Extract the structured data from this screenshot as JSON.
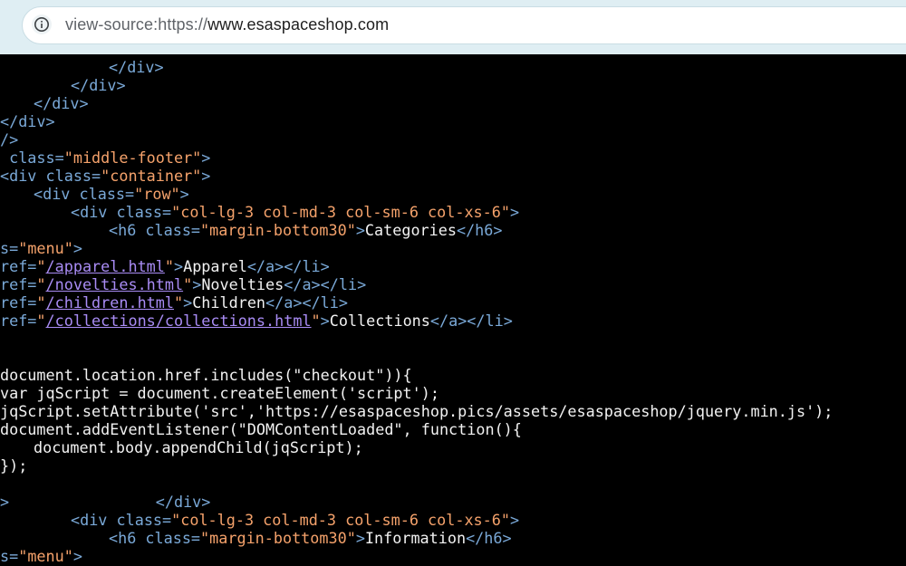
{
  "browser": {
    "url_scheme": "view-source:https://",
    "url_host": "www.esaspaceshop.com"
  },
  "icons": {
    "site_info": "info-icon"
  },
  "colors": {
    "chrome": "#dfeef3",
    "background": "#000000",
    "tag": "#7aa9d8",
    "attribute_value": "#f5a26b",
    "link": "#a98cf5",
    "text": "#f2f2f2"
  },
  "source_lines": [
    {
      "segments": []
    },
    {
      "segments": [
        {
          "t": "</div>",
          "c": "tag"
        }
      ]
    },
    {
      "segments": [
        {
          "t": "</div>",
          "c": "tag"
        }
      ]
    },
    {
      "segments": [
        {
          "t": "</div>",
          "c": "tag"
        }
      ]
    },
    {
      "segments": [
        {
          "t": "</div>",
          "c": "tag"
        }
      ]
    },
    {
      "segments": [
        {
          "t": "/>",
          "c": "tag"
        }
      ]
    },
    {
      "segments": [
        {
          "t": " class=",
          "c": "attr"
        },
        {
          "t": "\"middle-footer\"",
          "c": "val"
        },
        {
          "t": ">",
          "c": "tag"
        }
      ]
    },
    {
      "segments": [
        {
          "t": "<div class=",
          "c": "tag"
        },
        {
          "t": "\"container\"",
          "c": "val"
        },
        {
          "t": ">",
          "c": "tag"
        }
      ]
    },
    {
      "segments": [
        {
          "t": "<div class=",
          "c": "tag"
        },
        {
          "t": "\"row\"",
          "c": "val"
        },
        {
          "t": ">",
          "c": "tag"
        }
      ]
    },
    {
      "segments": [
        {
          "t": "<div class=",
          "c": "tag"
        },
        {
          "t": "\"col-lg-3 col-md-3 col-sm-6 col-xs-6\"",
          "c": "val"
        },
        {
          "t": ">",
          "c": "tag"
        }
      ]
    },
    {
      "segments": [
        {
          "t": "<h6 class=",
          "c": "tag"
        },
        {
          "t": "\"margin-bottom30\"",
          "c": "val"
        },
        {
          "t": ">",
          "c": "tag"
        },
        {
          "t": "Categories",
          "c": "txt"
        },
        {
          "t": "</h6>",
          "c": "tag"
        }
      ]
    },
    {
      "segments": [
        {
          "t": "s=",
          "c": "attr"
        },
        {
          "t": "\"menu\"",
          "c": "val"
        },
        {
          "t": ">",
          "c": "tag"
        }
      ]
    },
    {
      "segments": [
        {
          "t": "ref=",
          "c": "attr"
        },
        {
          "t": "\"",
          "c": "val"
        },
        {
          "t": "/apparel.html",
          "c": "link"
        },
        {
          "t": "\"",
          "c": "val"
        },
        {
          "t": ">",
          "c": "tag"
        },
        {
          "t": "Apparel",
          "c": "txt"
        },
        {
          "t": "</a></li>",
          "c": "tag"
        }
      ]
    },
    {
      "segments": [
        {
          "t": "ref=",
          "c": "attr"
        },
        {
          "t": "\"",
          "c": "val"
        },
        {
          "t": "/novelties.html",
          "c": "link"
        },
        {
          "t": "\"",
          "c": "val"
        },
        {
          "t": ">",
          "c": "tag"
        },
        {
          "t": "Novelties",
          "c": "txt"
        },
        {
          "t": "</a></li>",
          "c": "tag"
        }
      ]
    },
    {
      "segments": [
        {
          "t": "ref=",
          "c": "attr"
        },
        {
          "t": "\"",
          "c": "val"
        },
        {
          "t": "/children.html",
          "c": "link"
        },
        {
          "t": "\"",
          "c": "val"
        },
        {
          "t": ">",
          "c": "tag"
        },
        {
          "t": "Children",
          "c": "txt"
        },
        {
          "t": "</a></li>",
          "c": "tag"
        }
      ]
    },
    {
      "segments": [
        {
          "t": "ref=",
          "c": "attr"
        },
        {
          "t": "\"",
          "c": "val"
        },
        {
          "t": "/collections/collections.html",
          "c": "link"
        },
        {
          "t": "\"",
          "c": "val"
        },
        {
          "t": ">",
          "c": "tag"
        },
        {
          "t": "Collections",
          "c": "txt"
        },
        {
          "t": "</a></li>",
          "c": "tag"
        }
      ]
    },
    {
      "segments": []
    },
    {
      "segments": []
    },
    {
      "segments": [
        {
          "t": "document.location.href.includes(\"checkout\")){",
          "c": "txt"
        }
      ]
    },
    {
      "segments": [
        {
          "t": "var jqScript = document.createElement('script');",
          "c": "txt"
        }
      ]
    },
    {
      "segments": [
        {
          "t": "jqScript.setAttribute('src','https://esaspaceshop.pics/assets/esaspaceshop/jquery.min.js');",
          "c": "txt"
        }
      ]
    },
    {
      "segments": [
        {
          "t": "document.addEventListener(\"DOMContentLoaded\", function(){",
          "c": "txt"
        }
      ]
    },
    {
      "segments": [
        {
          "t": "document.body.appendChild(jqScript);",
          "c": "txt"
        }
      ]
    },
    {
      "segments": [
        {
          "t": "});",
          "c": "txt"
        }
      ]
    },
    {
      "segments": []
    },
    {
      "segments": [
        {
          "t": ">",
          "c": "tag"
        },
        {
          "t": "                ",
          "c": "txt"
        },
        {
          "t": "</div>",
          "c": "tag"
        }
      ]
    },
    {
      "segments": [
        {
          "t": "<div class=",
          "c": "tag"
        },
        {
          "t": "\"col-lg-3 col-md-3 col-sm-6 col-xs-6\"",
          "c": "val"
        },
        {
          "t": ">",
          "c": "tag"
        }
      ]
    },
    {
      "segments": [
        {
          "t": "<h6 class=",
          "c": "tag"
        },
        {
          "t": "\"margin-bottom30\"",
          "c": "val"
        },
        {
          "t": ">",
          "c": "tag"
        },
        {
          "t": "Information",
          "c": "txt"
        },
        {
          "t": "</h6>",
          "c": "tag"
        }
      ]
    },
    {
      "segments": [
        {
          "t": "s=",
          "c": "attr"
        },
        {
          "t": "\"menu\"",
          "c": "val"
        },
        {
          "t": ">",
          "c": "tag"
        }
      ]
    }
  ]
}
